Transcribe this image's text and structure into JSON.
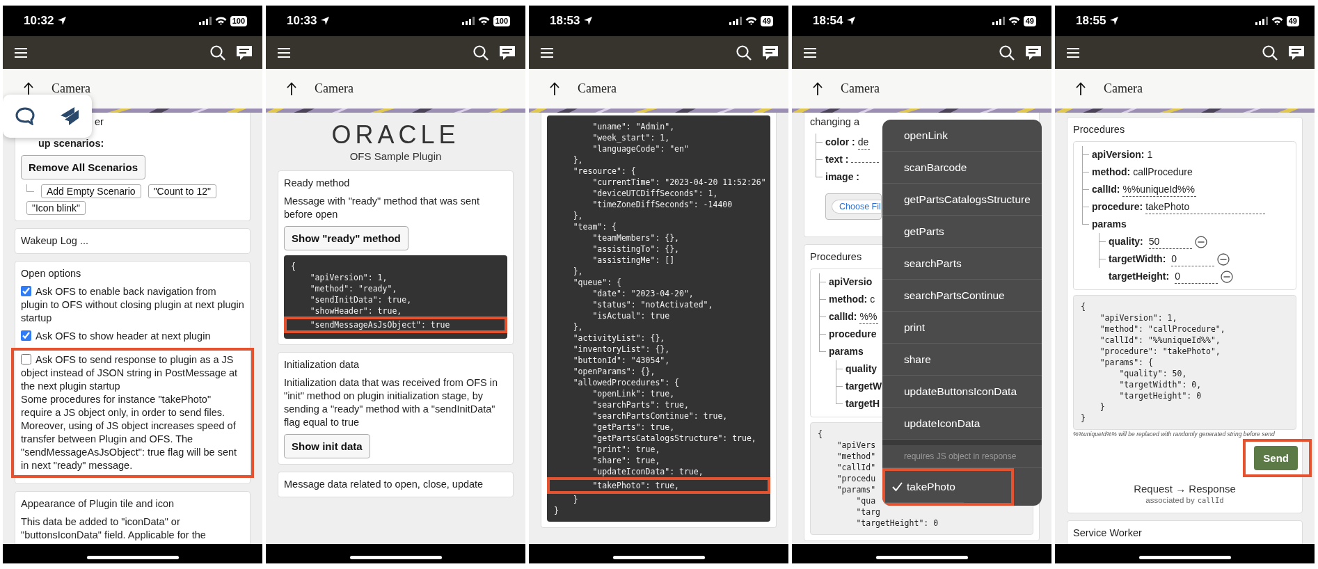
{
  "phones": [
    {
      "status": {
        "time": "10:32",
        "battery": "100"
      },
      "title": "Camera",
      "popup": {
        "kind": "icon_tray"
      },
      "content": [
        {
          "kind": "card_continued",
          "items": [
            {
              "kind": "tail_text",
              "text": "er"
            },
            {
              "kind": "tail_heading",
              "text": "up scenarios:"
            },
            {
              "kind": "button",
              "label": "Remove All Scenarios"
            },
            {
              "kind": "chips",
              "labels": [
                "Add Empty Scenario",
                "\"Count to 12\"",
                "\"Icon blink\""
              ]
            }
          ]
        },
        {
          "kind": "card",
          "items": [
            {
              "kind": "heading",
              "text": "Wakeup Log ..."
            }
          ]
        },
        {
          "kind": "card",
          "items": [
            {
              "kind": "heading",
              "text": "Open options"
            },
            {
              "kind": "checkbox",
              "label": "Ask OFS to enable back navigation from plugin to OFS without closing plugin at next plugin startup",
              "checked": true
            },
            {
              "kind": "checkbox",
              "label": "Ask OFS to show header at next plugin",
              "checked": true
            },
            {
              "kind": "highlight_box",
              "items": [
                {
                  "kind": "checkbox",
                  "label": "Ask OFS to send response to plugin as a JS object instead of JSON string in PostMessage at the next plugin startup",
                  "checked": false
                },
                {
                  "kind": "text",
                  "text": "Some procedures for instance \"takePhoto\" require a JS object only, in order to send files. Moreover, using of JS object increases speed of transfer between Plugin and OFS. The \"sendMessageAsJsObject\": true flag will be sent in next \"ready\" message."
                }
              ]
            }
          ]
        },
        {
          "kind": "card",
          "items": [
            {
              "kind": "heading",
              "text": "Appearance of Plugin tile and icon"
            },
            {
              "kind": "text",
              "text": "This data be added to \"iconData\" or \"buttonsIconData\" field. Applicable for the"
            }
          ]
        }
      ]
    },
    {
      "status": {
        "time": "10:33",
        "battery": "100"
      },
      "title": "Camera",
      "content": [
        {
          "kind": "logo",
          "text": "ORACLE"
        },
        {
          "kind": "subtitle",
          "text": "OFS Sample Plugin"
        },
        {
          "kind": "card",
          "items": [
            {
              "kind": "heading",
              "text": "Ready method"
            },
            {
              "kind": "text",
              "text": "Message with \"ready\" method that was sent before open"
            },
            {
              "kind": "button",
              "label": "Show \"ready\" method"
            },
            {
              "kind": "dark_code",
              "parts": [
                {
                  "kind": "plain",
                  "lines": [
                    "{",
                    "    \"apiVersion\": 1,",
                    "    \"method\": \"ready\",",
                    "    \"sendInitData\": true,",
                    "    \"showHeader\": true,"
                  ]
                },
                {
                  "kind": "highlight",
                  "lines": [
                    "    \"sendMessageAsJsObject\": true"
                  ]
                }
              ]
            }
          ]
        },
        {
          "kind": "card",
          "items": [
            {
              "kind": "heading",
              "text": "Initialization data"
            },
            {
              "kind": "text",
              "text": "Initialization data that was received from OFS in \"init\" method on plugin initialization stage, by sending a \"ready\" method with a \"sendInitData\" flag equal to true"
            },
            {
              "kind": "button",
              "label": "Show init data"
            }
          ]
        },
        {
          "kind": "card",
          "items": [
            {
              "kind": "heading",
              "text": "Message data related to open, close, update"
            }
          ]
        }
      ]
    },
    {
      "status": {
        "time": "18:53",
        "battery": "49"
      },
      "title": "Camera",
      "content": [
        {
          "kind": "card_continued",
          "items": [
            {
              "kind": "dark_code",
              "parts": [
                {
                  "kind": "plain",
                  "lines": [
                    "        \"uname\": \"Admin\",",
                    "        \"week_start\": 1,",
                    "        \"languageCode\": \"en\"",
                    "    },",
                    "    \"resource\": {",
                    "        \"currentTime\": \"2023-04-20 11:52:26\"",
                    "        \"deviceUTCDiffSeconds\": 1,",
                    "        \"timeZoneDiffSeconds\": -14400",
                    "    },",
                    "    \"team\": {",
                    "        \"teamMembers\": {},",
                    "        \"assistingTo\": {},",
                    "        \"assistingMe\": []",
                    "    },",
                    "    \"queue\": {",
                    "        \"date\": \"2023-04-20\",",
                    "        \"status\": \"notActivated\",",
                    "        \"isActual\": true",
                    "    },",
                    "    \"activityList\": {},",
                    "    \"inventoryList\": {},",
                    "    \"buttonId\": \"43054\",",
                    "    \"openParams\": {},",
                    "    \"allowedProcedures\": {",
                    "        \"openLink\": true,",
                    "        \"searchParts\": true,",
                    "        \"searchPartsContinue\": true,",
                    "        \"getParts\": true,",
                    "        \"getPartsCatalogsStructure\": true,",
                    "        \"print\": true,",
                    "        \"share\": true,",
                    "        \"updateIconData\": true,"
                  ]
                },
                {
                  "kind": "highlight",
                  "lines": [
                    "        \"takePhoto\": true,"
                  ]
                },
                {
                  "kind": "plain",
                  "lines": [
                    "    }",
                    "}"
                  ]
                }
              ]
            }
          ]
        }
      ]
    },
    {
      "status": {
        "time": "18:54",
        "battery": "49"
      },
      "title": "Camera",
      "content": [
        {
          "kind": "card_continued",
          "items": [
            {
              "kind": "short_text",
              "text": "changing a"
            },
            {
              "kind": "tree",
              "nodes": [
                {
                  "kind": "field",
                  "key": "color :",
                  "value": "de"
                },
                {
                  "kind": "empty_field",
                  "key": "text :"
                },
                {
                  "kind": "key",
                  "key": "image :"
                }
              ]
            },
            {
              "kind": "file",
              "label": "Choose Fil"
            }
          ]
        },
        {
          "kind": "card",
          "items": [
            {
              "kind": "heading",
              "text": "Procedures"
            },
            {
              "kind": "tree_box",
              "nodes": [
                {
                  "kind": "key",
                  "key": "apiVersio"
                },
                {
                  "kind": "pair",
                  "key": "method:",
                  "value": "c"
                },
                {
                  "kind": "field",
                  "key": "callId:",
                  "value": "%%"
                },
                {
                  "kind": "key",
                  "key": "procedure"
                },
                {
                  "kind": "group",
                  "key": "params",
                  "children": [
                    {
                      "kind": "key",
                      "key": "quality"
                    },
                    {
                      "kind": "key",
                      "key": "targetW"
                    },
                    {
                      "kind": "key",
                      "key": "targetH"
                    }
                  ]
                }
              ]
            },
            {
              "kind": "light_code",
              "parts": [
                {
                  "kind": "plain",
                  "lines": [
                    "{",
                    "    \"apiVers",
                    "    \"method\"",
                    "    \"callId\"",
                    "    \"procedu",
                    "    \"params\""
                  ]
                },
                {
                  "kind": "plain",
                  "lines": [
                    "        \"qua",
                    "        \"targ",
                    "        \"targetHeight\": 0"
                  ]
                }
              ]
            }
          ]
        }
      ],
      "menu": {
        "items": [
          {
            "kind": "option",
            "label": "openLink",
            "selected": false
          },
          {
            "kind": "option",
            "label": "scanBarcode",
            "selected": false
          },
          {
            "kind": "option",
            "label": "getPartsCatalogsStructure",
            "selected": false
          },
          {
            "kind": "option",
            "label": "getParts",
            "selected": false
          },
          {
            "kind": "option",
            "label": "searchParts",
            "selected": false
          },
          {
            "kind": "option",
            "label": "searchPartsContinue",
            "selected": false
          },
          {
            "kind": "option",
            "label": "print",
            "selected": false
          },
          {
            "kind": "option",
            "label": "share",
            "selected": false
          },
          {
            "kind": "option",
            "label": "updateButtonsIconData",
            "selected": false
          },
          {
            "kind": "option",
            "label": "updateIconData",
            "selected": false
          },
          {
            "kind": "header",
            "label": "requires JS object in response"
          },
          {
            "kind": "highlighted_option",
            "label": "takePhoto",
            "selected": true
          }
        ]
      }
    },
    {
      "status": {
        "time": "18:55",
        "battery": "49"
      },
      "title": "Camera",
      "content": [
        {
          "kind": "card",
          "items": [
            {
              "kind": "heading",
              "text": "Procedures"
            },
            {
              "kind": "tree_box",
              "nodes": [
                {
                  "kind": "pair",
                  "key": "apiVersion:",
                  "value": "1"
                },
                {
                  "kind": "pair",
                  "key": "method:",
                  "value": "callProcedure"
                },
                {
                  "kind": "field",
                  "key": "callId:",
                  "value": "%%uniqueId%%"
                },
                {
                  "kind": "wide_field",
                  "key": "procedure:",
                  "value": "takePhoto"
                },
                {
                  "kind": "group",
                  "key": "params",
                  "children": [
                    {
                      "kind": "removable_field",
                      "key": "quality:",
                      "value": "50"
                    },
                    {
                      "kind": "removable_field",
                      "key": "targetWidth:",
                      "value": "0"
                    },
                    {
                      "kind": "removable_field",
                      "key": "targetHeight:",
                      "value": "0"
                    }
                  ]
                }
              ]
            },
            {
              "kind": "light_code",
              "parts": [
                {
                  "kind": "plain",
                  "lines": [
                    "{",
                    "    \"apiVersion\": 1,",
                    "    \"method\": \"callProcedure\",",
                    "    \"callId\": \"%%uniqueId%%\",",
                    "    \"procedure\": \"takePhoto\",",
                    "    \"params\": {",
                    "        \"quality\": 50,",
                    "        \"targetWidth\": 0,",
                    "        \"targetHeight\": 0",
                    "    }",
                    "}"
                  ]
                }
              ]
            },
            {
              "kind": "note",
              "text": "%%uniqueId%% will be replaced with randomly generated string before send"
            },
            {
              "kind": "highlighted_send",
              "label": "Send"
            },
            {
              "kind": "center_text",
              "text": "Request → Response"
            },
            {
              "kind": "caption",
              "text": "associated by",
              "code": "callId"
            }
          ]
        },
        {
          "kind": "card",
          "items": [
            {
              "kind": "heading",
              "text": "Service Worker"
            }
          ]
        }
      ]
    }
  ]
}
